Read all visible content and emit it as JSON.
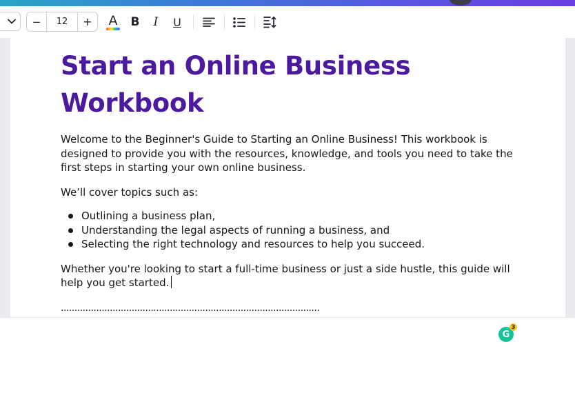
{
  "toolbar": {
    "font_size": "12",
    "decrease_label": "−",
    "increase_label": "+",
    "text_color_letter": "A",
    "bold_label": "B",
    "italic_label": "I",
    "underline_label": "U"
  },
  "document": {
    "title_line1": "Start an Online Business",
    "title_line2": "Workbook",
    "intro": "Welcome to the Beginner's Guide to Starting an Online Business! This workbook is designed to provide you with the resources, knowledge, and tools you need to take the first steps in starting your own online business.",
    "topics_lead": "We’ll cover topics such as:",
    "topics": [
      "Outlining a business plan,",
      "Understanding the legal aspects of running a business, and",
      "Selecting the right technology and resources to help you succeed."
    ],
    "closing": "Whether you're looking to start a full-time business or just a side hustle, this guide will help you get started.",
    "divider_dots": "..............................................................................................."
  },
  "grammarly": {
    "letter": "G",
    "count": "3"
  },
  "colors": {
    "title": "#4b1a9e",
    "grammarly": "#15c39a",
    "badge": "#f6c22b"
  }
}
